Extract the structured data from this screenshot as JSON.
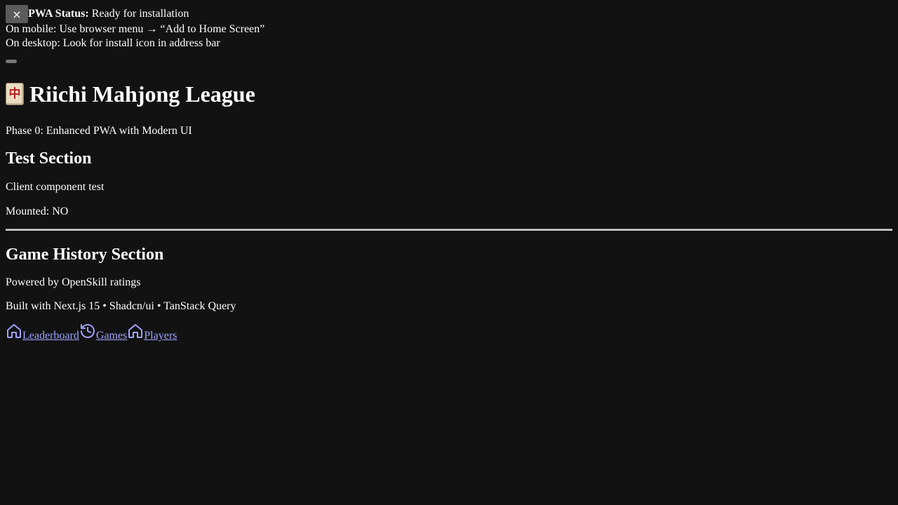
{
  "pwa_banner": {
    "close_icon": "×",
    "status_label": "PWA Status:",
    "status_value": "Ready for installation",
    "mobile_hint": "On mobile: Use browser menu → “Add to Home Screen”",
    "desktop_hint": "On desktop: Look for install icon in address bar"
  },
  "header": {
    "title": "Riichi Mahjong League",
    "tile_glyph": "中",
    "subtitle": "Phase 0: Enhanced PWA with Modern UI"
  },
  "test_section": {
    "heading": "Test Section",
    "description": "Client component test",
    "mounted": "Mounted: NO"
  },
  "history_section": {
    "heading": "Game History Section",
    "powered_by": "Powered by OpenSkill ratings",
    "built_with": "Built with Next.js 15 • Shadcn/ui • TanStack Query"
  },
  "nav": {
    "items": [
      {
        "label": "Leaderboard",
        "icon": "home-icon"
      },
      {
        "label": "Games",
        "icon": "history-icon"
      },
      {
        "label": "Players",
        "icon": "home-icon"
      }
    ]
  },
  "colors": {
    "background": "#121212",
    "text": "#ffffff",
    "link": "#9fa3ff",
    "close_button": "#5b5b5b"
  }
}
